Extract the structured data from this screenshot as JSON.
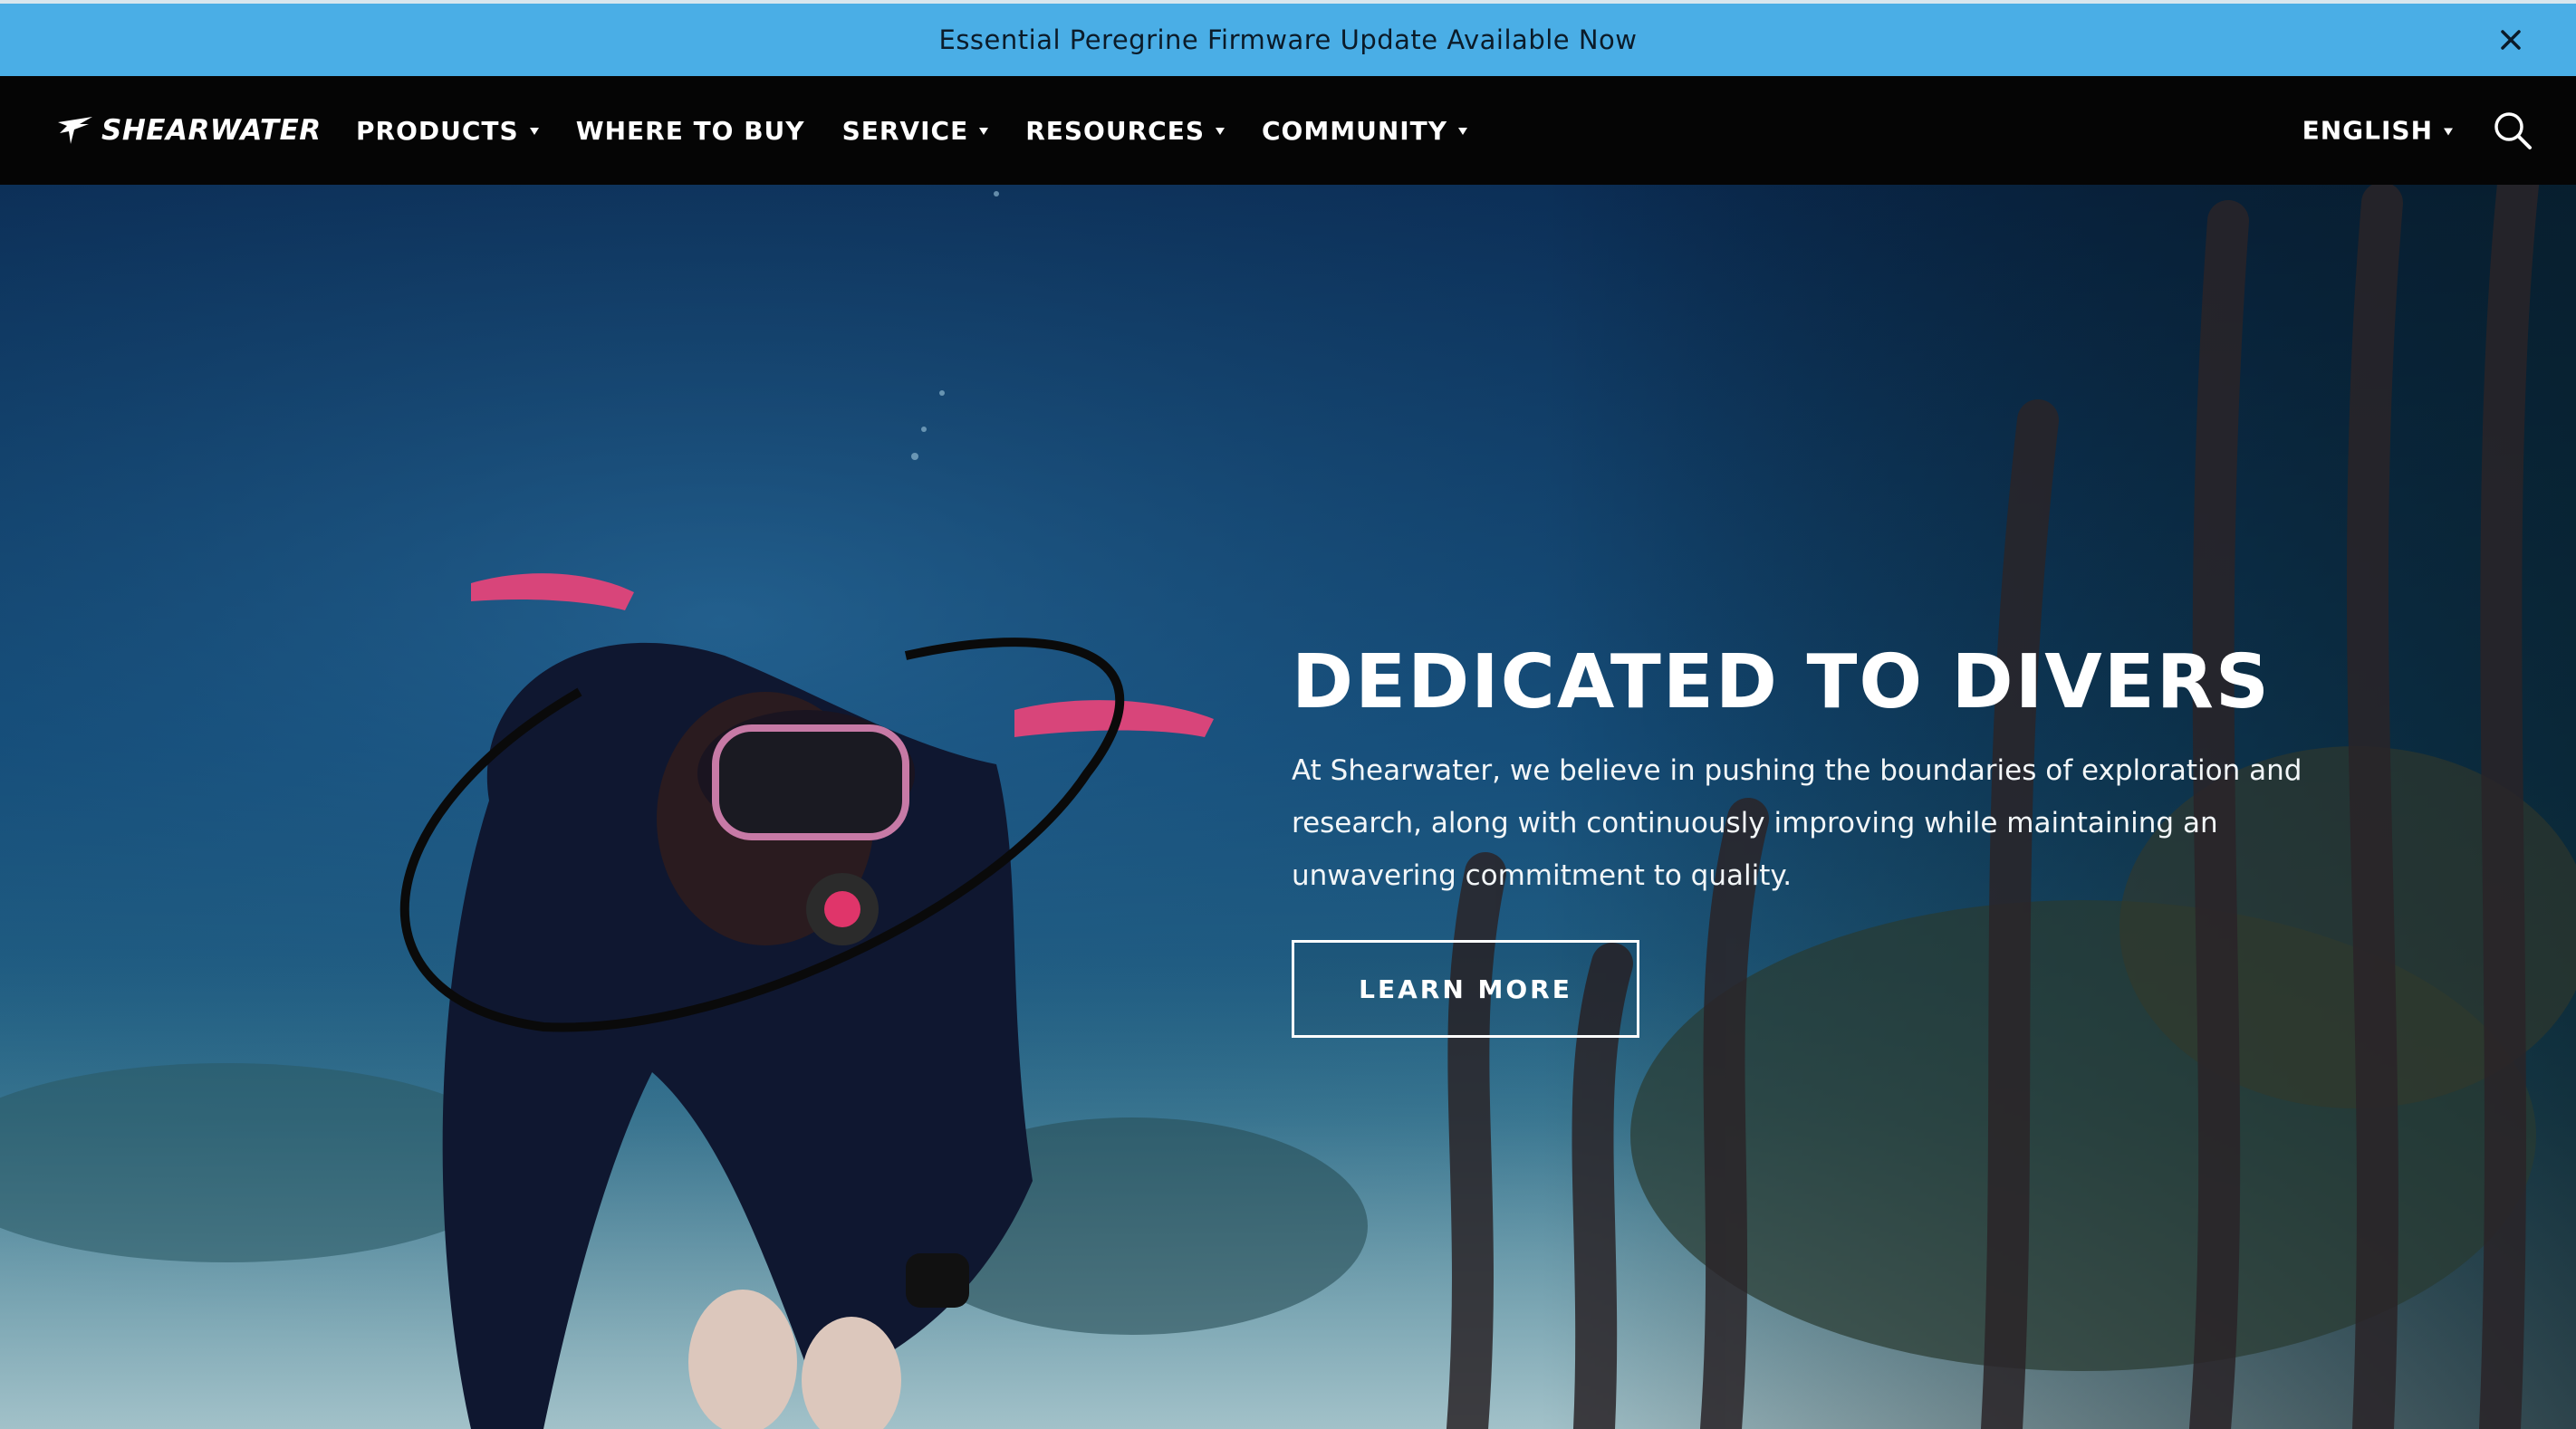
{
  "announcement": {
    "text": "Essential Peregrine Firmware Update Available Now",
    "close_icon": "close-icon"
  },
  "nav": {
    "logo_text": "SHEARWATER",
    "items": [
      {
        "label": "PRODUCTS",
        "has_dropdown": true
      },
      {
        "label": "WHERE TO BUY",
        "has_dropdown": false
      },
      {
        "label": "SERVICE",
        "has_dropdown": true
      },
      {
        "label": "RESOURCES",
        "has_dropdown": true
      },
      {
        "label": "COMMUNITY",
        "has_dropdown": true
      }
    ],
    "language": "ENGLISH",
    "search_icon": "search-icon"
  },
  "hero": {
    "title": "DEDICATED TO DIVERS",
    "body": "At Shearwater, we believe in pushing the boundaries of exploration and research, along with continuously improving while maintaining an unwavering commitment to quality.",
    "button_label": "LEARN MORE"
  },
  "colors": {
    "announcement_bg": "#4aaee6",
    "nav_bg": "#050505",
    "text_light": "#ffffff"
  }
}
